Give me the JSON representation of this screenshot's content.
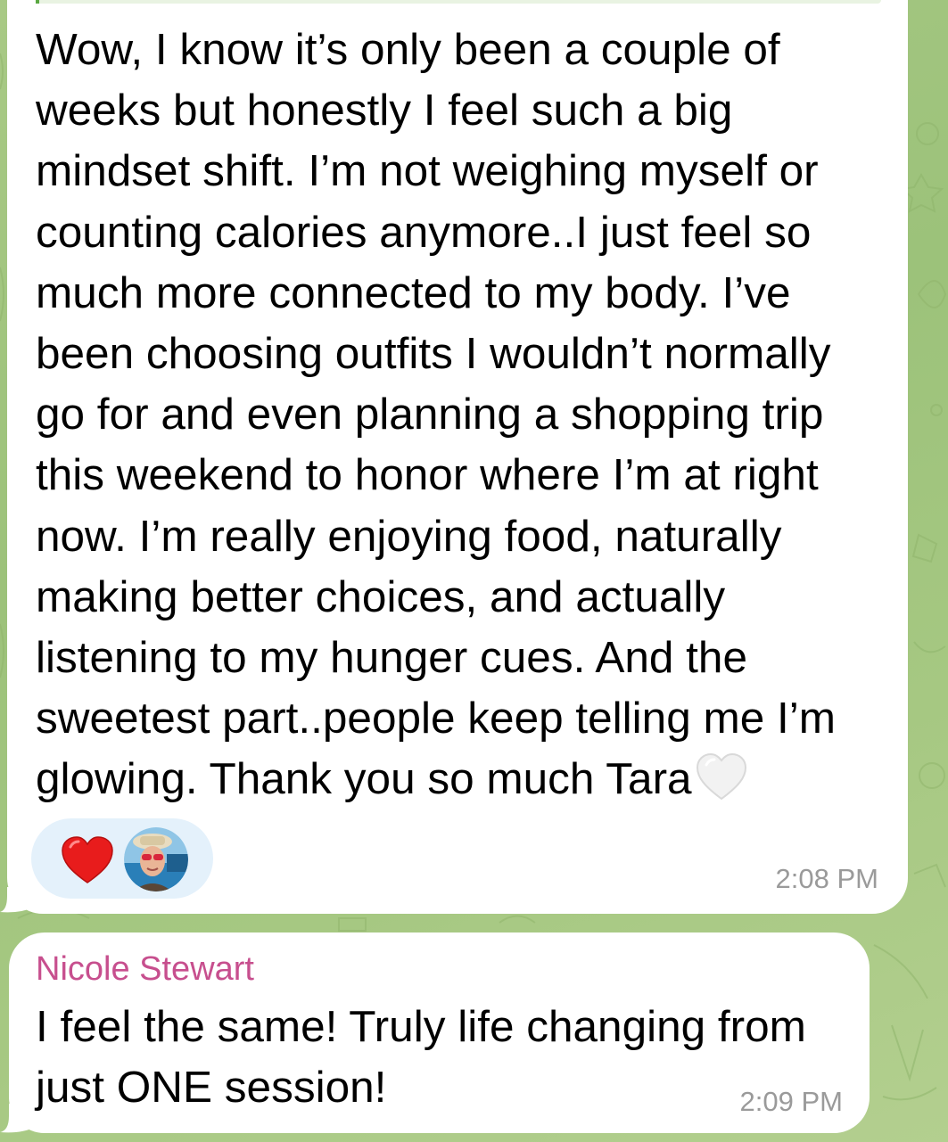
{
  "theme": {
    "chat_background": "#a3c67f",
    "bubble_color": "#ffffff",
    "timestamp_color": "#9a9a9a",
    "sender_name_color": "#c74f8e",
    "reaction_pill_color": "#e4f1fb",
    "reply_accent_color": "#5aa841"
  },
  "messages": [
    {
      "text": "Wow, I know it’s only been a couple of weeks but honestly I feel such a big mindset shift. I’m not weighing myself or counting calories anymore..I just feel so much more connected to my body. I’ve been choosing outfits I wouldn’t normally go for and even planning a shopping trip this weekend to honor where I’m at right now. I’m really enjoying food, naturally making better choices, and actually listening to my hunger cues. And the sweetest part..people keep telling me I’m glowing. Thank you so much Tara",
      "trailing_emoji": "white-heart-icon",
      "reactions": {
        "emoji": "red-heart-icon",
        "avatar": "user-avatar-photo"
      },
      "time": "2:08 PM"
    },
    {
      "sender": "Nicole Stewart",
      "text": "I feel the same! Truly life changing from just ONE session!",
      "time": "2:09 PM"
    }
  ]
}
